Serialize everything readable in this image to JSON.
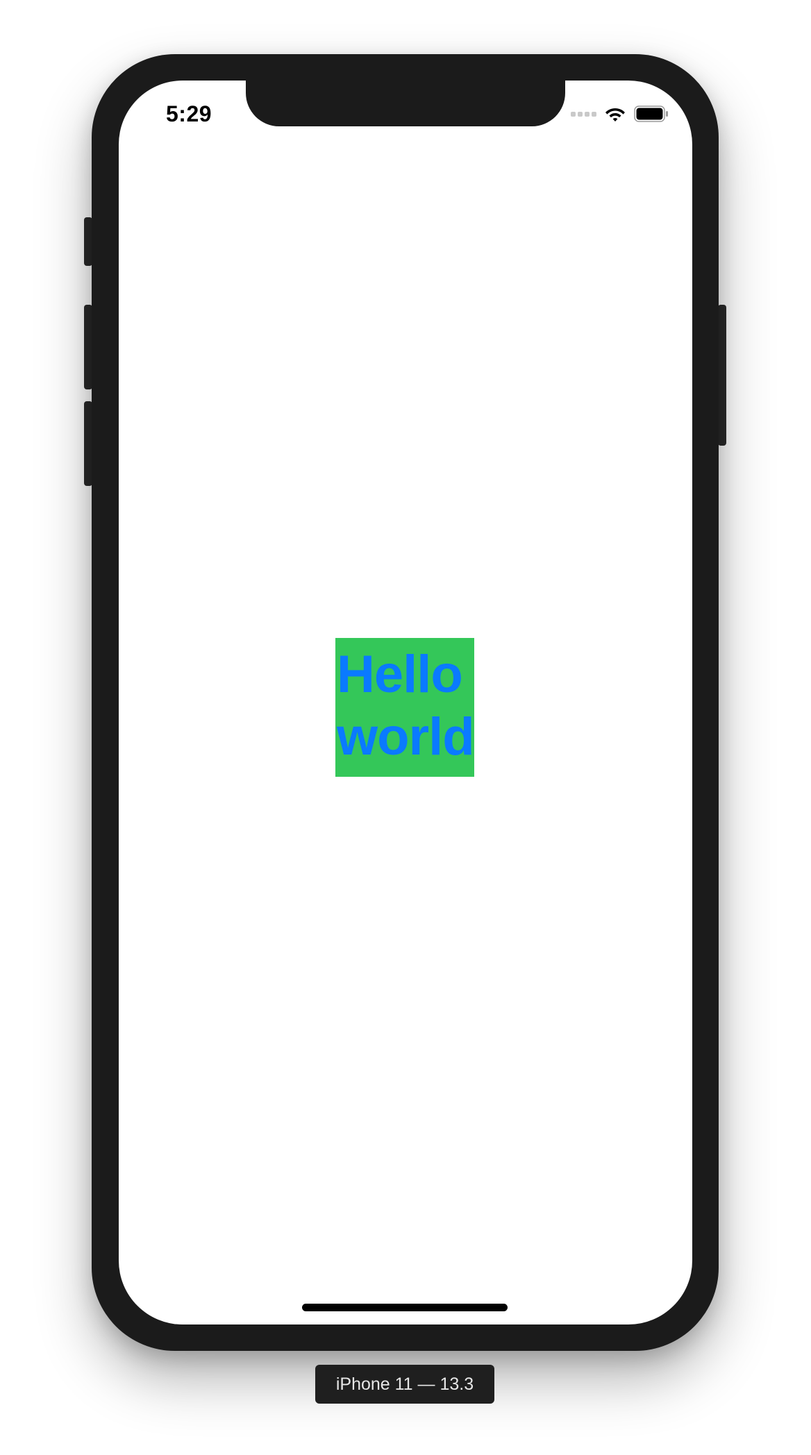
{
  "status_bar": {
    "time": "5:29",
    "icons": [
      "signal-icon",
      "wifi-icon",
      "battery-icon"
    ]
  },
  "content": {
    "label_text": "Hello\nworld",
    "label_text_color": "#0a7aff",
    "label_background_color": "#34c759"
  },
  "simulator": {
    "device_label": "iPhone 11 — 13.3",
    "frame_color": "#1b1b1b"
  }
}
